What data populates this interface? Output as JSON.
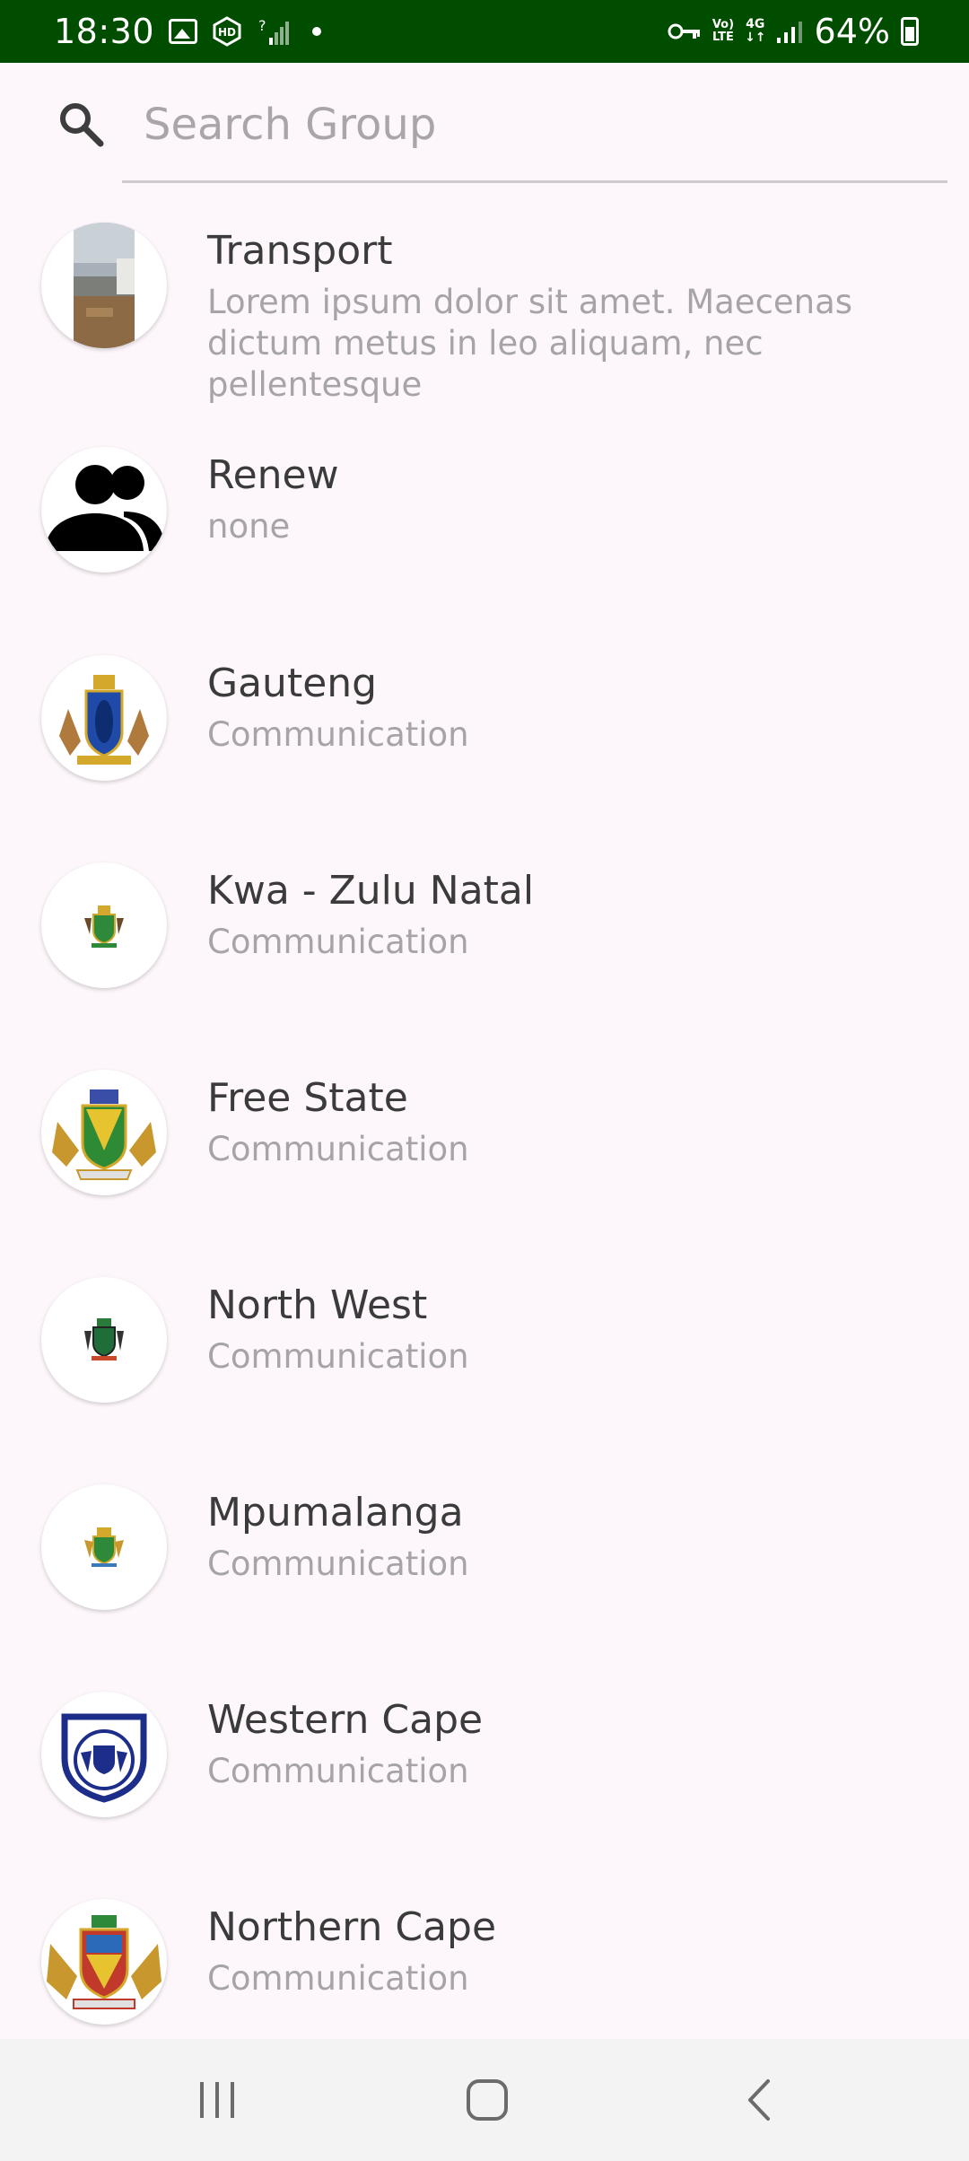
{
  "status_bar": {
    "time": "18:30",
    "battery": "64%",
    "volte_line1": "Vo)",
    "volte_line2": "LTE",
    "network": "4G",
    "network_arrows": "↓↑"
  },
  "search": {
    "placeholder": "Search Group",
    "icon": "search-icon"
  },
  "groups": [
    {
      "title": "Transport",
      "subtitle": "Lorem ipsum dolor sit amet. Maecenas dictum metus in leo aliquam, nec pellentesque",
      "avatar": "transport-photo"
    },
    {
      "title": "Renew",
      "subtitle": "none",
      "avatar": "people-icon"
    },
    {
      "title": "Gauteng",
      "subtitle": "Communication",
      "avatar": "gauteng-coat-of-arms"
    },
    {
      "title": "Kwa - Zulu Natal",
      "subtitle": "Communication",
      "avatar": "kzn-coat-of-arms"
    },
    {
      "title": "Free State",
      "subtitle": "Communication",
      "avatar": "free-state-coat-of-arms"
    },
    {
      "title": "North West",
      "subtitle": "Communication",
      "avatar": "north-west-coat-of-arms"
    },
    {
      "title": "Mpumalanga",
      "subtitle": "Communication",
      "avatar": "mpumalanga-coat-of-arms"
    },
    {
      "title": "Western Cape",
      "subtitle": "Communication",
      "avatar": "western-cape-coat-of-arms"
    },
    {
      "title": "Northern Cape",
      "subtitle": "Communication",
      "avatar": "northern-cape-coat-of-arms"
    }
  ],
  "nav": {
    "recents": "recents-icon",
    "home": "home-icon",
    "back": "back-icon"
  },
  "colors": {
    "status_bar": "#004d00",
    "background": "#fdf7fb",
    "title_text": "#3b3b3b",
    "subtitle_text": "#a7a4a8"
  }
}
